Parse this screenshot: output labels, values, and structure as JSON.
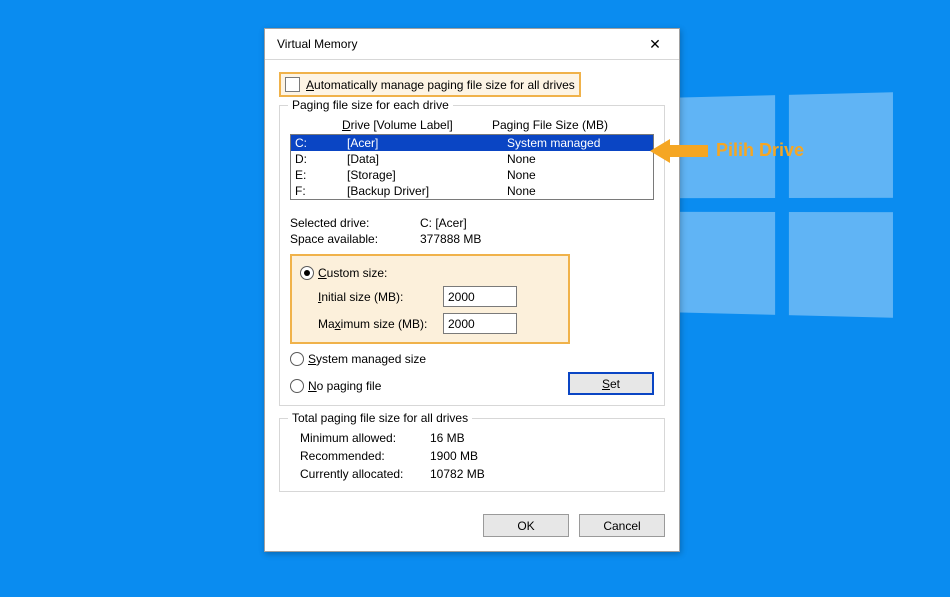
{
  "window": {
    "title": "Virtual Memory",
    "close_glyph": "✕"
  },
  "auto_manage": {
    "checked": false,
    "label_pre": "A",
    "label_rest": "utomatically manage paging file size for all drives"
  },
  "drive_group": {
    "legend": "Paging file size for each drive",
    "header_drive_u": "D",
    "header_drive_rest": "rive  [Volume Label]",
    "header_size": "Paging File Size (MB)",
    "rows": [
      {
        "letter": "C:",
        "label": "[Acer]",
        "size": "System managed",
        "selected": true
      },
      {
        "letter": "D:",
        "label": "[Data]",
        "size": "None",
        "selected": false
      },
      {
        "letter": "E:",
        "label": "[Storage]",
        "size": "None",
        "selected": false
      },
      {
        "letter": "F:",
        "label": "[Backup Driver]",
        "size": "None",
        "selected": false
      }
    ],
    "selected_drive_label": "Selected drive:",
    "selected_drive_value": "C:  [Acer]",
    "space_label": "Space available:",
    "space_value": "377888 MB"
  },
  "size_options": {
    "custom_u": "C",
    "custom_rest": "ustom size:",
    "initial_u": "I",
    "initial_rest": "nitial size (MB):",
    "initial_value": "2000",
    "max_pre": "Ma",
    "max_u": "x",
    "max_rest": "imum size (MB):",
    "max_value": "2000",
    "sys_u": "S",
    "sys_rest": "ystem managed size",
    "none_u": "N",
    "none_rest": "o paging file",
    "set_u": "S",
    "set_rest": "et"
  },
  "totals": {
    "legend": "Total paging file size for all drives",
    "min_label": "Minimum allowed:",
    "min_value": "16 MB",
    "rec_label": "Recommended:",
    "rec_value": "1900 MB",
    "cur_label": "Currently allocated:",
    "cur_value": "10782 MB"
  },
  "buttons": {
    "ok": "OK",
    "cancel": "Cancel"
  },
  "annotation": {
    "label": "Pilih Drive"
  }
}
